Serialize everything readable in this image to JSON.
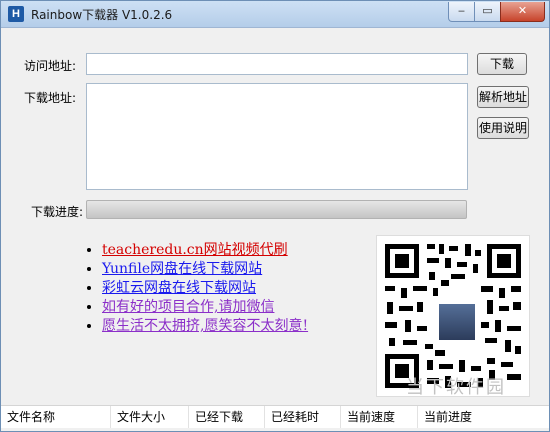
{
  "window": {
    "title": "Rainbow下载器 V1.0.2.6",
    "icon_letter": "H",
    "min": "‒",
    "max": "▭",
    "close": "✕"
  },
  "form": {
    "url_label": "访问地址:",
    "url_value": "",
    "download_label": "下载地址:",
    "download_value": "",
    "progress_label": "下载进度:",
    "progress": 0
  },
  "buttons": {
    "download": "下载",
    "parse": "解析地址",
    "help": "使用说明"
  },
  "links": [
    {
      "text": "teacheredu.cn网站视频代刷",
      "color": "#d40000"
    },
    {
      "text": "Yunfile网盘在线下载网站",
      "color": "#1a1aee"
    },
    {
      "text": "彩虹云网盘在线下载网站",
      "color": "#1a1aee"
    },
    {
      "text": "如有好的项目合作,请加微信",
      "color": "#8b2fc9"
    },
    {
      "text": "愿生活不太拥挤,愿笑容不太刻意!",
      "color": "#8b2fc9"
    }
  ],
  "watermark": "当下软件园",
  "table": {
    "columns": [
      "文件名称",
      "文件大小",
      "已经下载",
      "已经耗时",
      "当前速度",
      "当前进度"
    ]
  }
}
